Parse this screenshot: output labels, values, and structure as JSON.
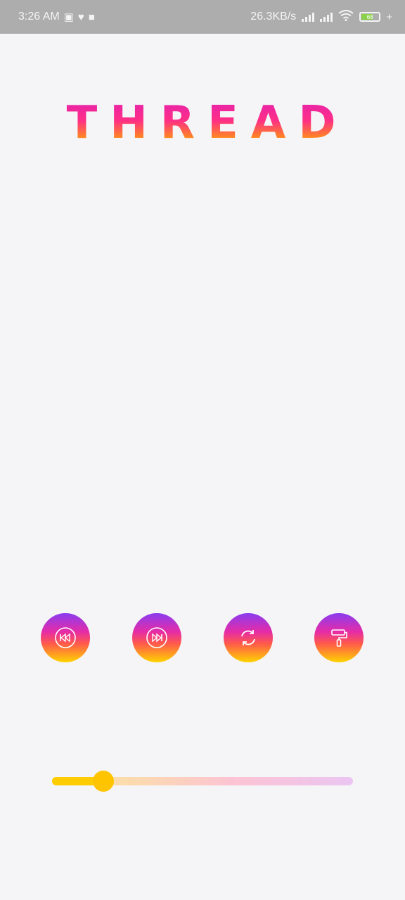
{
  "status_bar": {
    "time": "3:26 AM",
    "net_speed": "26.3KB/s",
    "battery_level": "68",
    "battery_fraction": 0.68,
    "battery_color": "#8bd24a",
    "icons": [
      "screenshot-icon",
      "heart-icon",
      "video-icon",
      "signal-icon",
      "signal-icon",
      "wifi-icon",
      "battery-icon",
      "charging-icon"
    ]
  },
  "app": {
    "title": "THREAD",
    "title_gradient": [
      "#e01fb3",
      "#ff2f86",
      "#ff8c1a",
      "#ffd000"
    ]
  },
  "controls": [
    {
      "name": "rewind-button",
      "icon": "rewind-icon"
    },
    {
      "name": "fast-forward-button",
      "icon": "fast-forward-icon"
    },
    {
      "name": "refresh-button",
      "icon": "refresh-icon"
    },
    {
      "name": "paint-roller-button",
      "icon": "paint-roller-icon"
    }
  ],
  "slider": {
    "value": 0.17,
    "fill_color": "#ffcc00"
  }
}
